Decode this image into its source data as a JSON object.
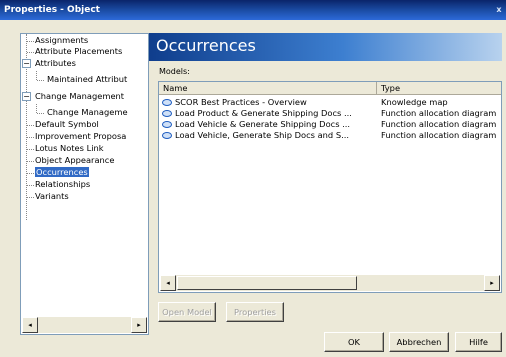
{
  "window": {
    "title": "Properties - Object",
    "close_glyph": "x"
  },
  "tree": {
    "items": [
      {
        "label": "Assignments"
      },
      {
        "label": "Attribute Placements"
      },
      {
        "label": "Attributes",
        "expander": "−"
      },
      {
        "label": "Maintained Attribut"
      },
      {
        "label": "Change Management",
        "expander": "−"
      },
      {
        "label": "Change Manageme"
      },
      {
        "label": "Default Symbol"
      },
      {
        "label": "Improvement Proposa"
      },
      {
        "label": "Lotus Notes Link"
      },
      {
        "label": "Object Appearance"
      },
      {
        "label": "Occurrences",
        "selected": true
      },
      {
        "label": "Relationships"
      },
      {
        "label": "Variants"
      }
    ]
  },
  "header": {
    "title": "Occurrences"
  },
  "models": {
    "label": "Models:",
    "columns": [
      "Name",
      "Type"
    ],
    "rows": [
      {
        "name": "SCOR Best Practices - Overview",
        "type": "Knowledge map"
      },
      {
        "name": "Load Product & Generate Shipping Docs ...",
        "type": "Function allocation diagram"
      },
      {
        "name": "Load Vehicle & Generate Shipping Docs ...",
        "type": "Function allocation diagram"
      },
      {
        "name": "Load Vehicle, Generate Ship Docs and S...",
        "type": "Function allocation diagram"
      }
    ]
  },
  "buttons": {
    "open_model": "Open Model",
    "properties": "Properties",
    "ok": "OK",
    "cancel": "Abbrechen",
    "help": "Hilfe"
  },
  "scroll": {
    "left": "◂",
    "right": "▸"
  }
}
